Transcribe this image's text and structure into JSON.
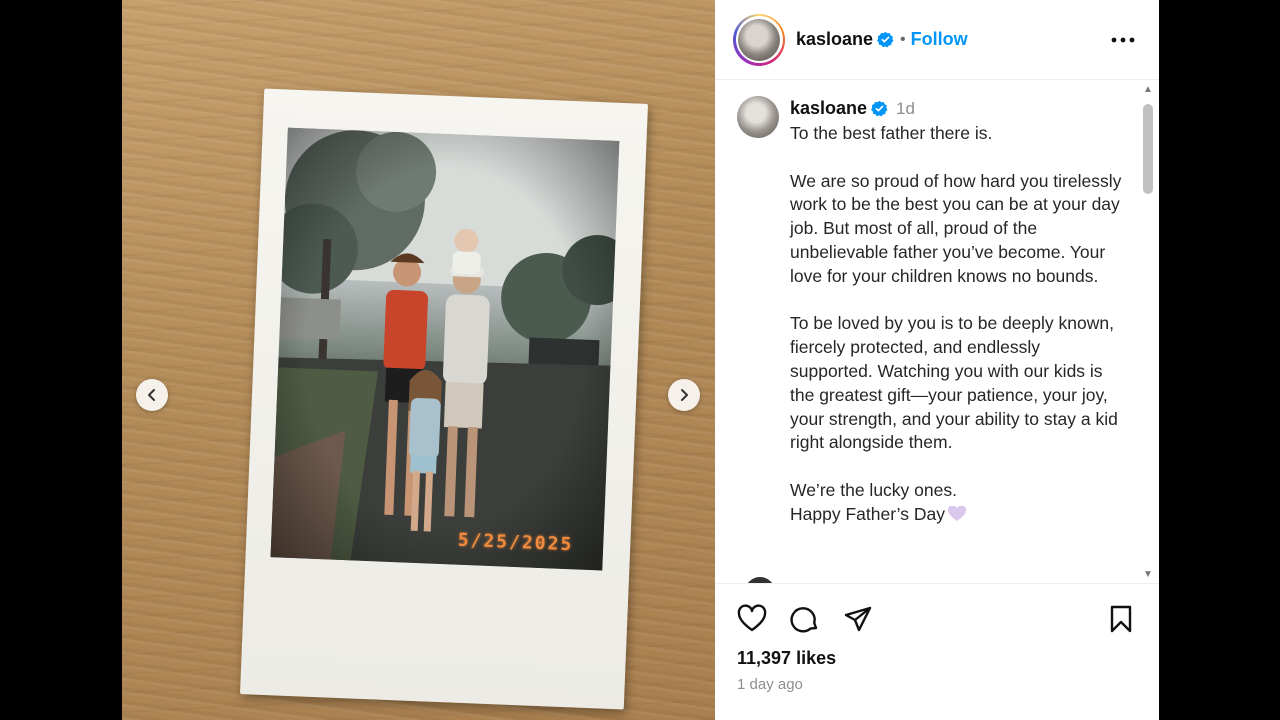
{
  "post": {
    "photo_date_stamp": "5/25/2025"
  },
  "header": {
    "username": "kasloane",
    "separator": "•",
    "follow_label": "Follow"
  },
  "caption": {
    "username": "kasloane",
    "time": "1d",
    "text": "To the best father there is.\n\nWe are so proud of how hard you tirelessly work to be the best you can be at your day job. But most of all, proud of the unbelievable father you’ve become. Your love for your children knows no bounds.\n\nTo be loved by you is to be deeply known, fiercely protected, and endlessly supported. Watching you with our kids is the greatest gift—your patience, your joy, your strength, and your ability to stay a kid right alongside them.\n\nWe’re the lucky ones.\nHappy Father’s Day",
    "emoji": "purple-heart"
  },
  "stats": {
    "likes": "11,397 likes",
    "posted_ago": "1 day ago"
  },
  "colors": {
    "accent_blue": "#0095f6",
    "verified_blue": "#0095f6",
    "date_stamp_orange": "#f08a3c"
  }
}
